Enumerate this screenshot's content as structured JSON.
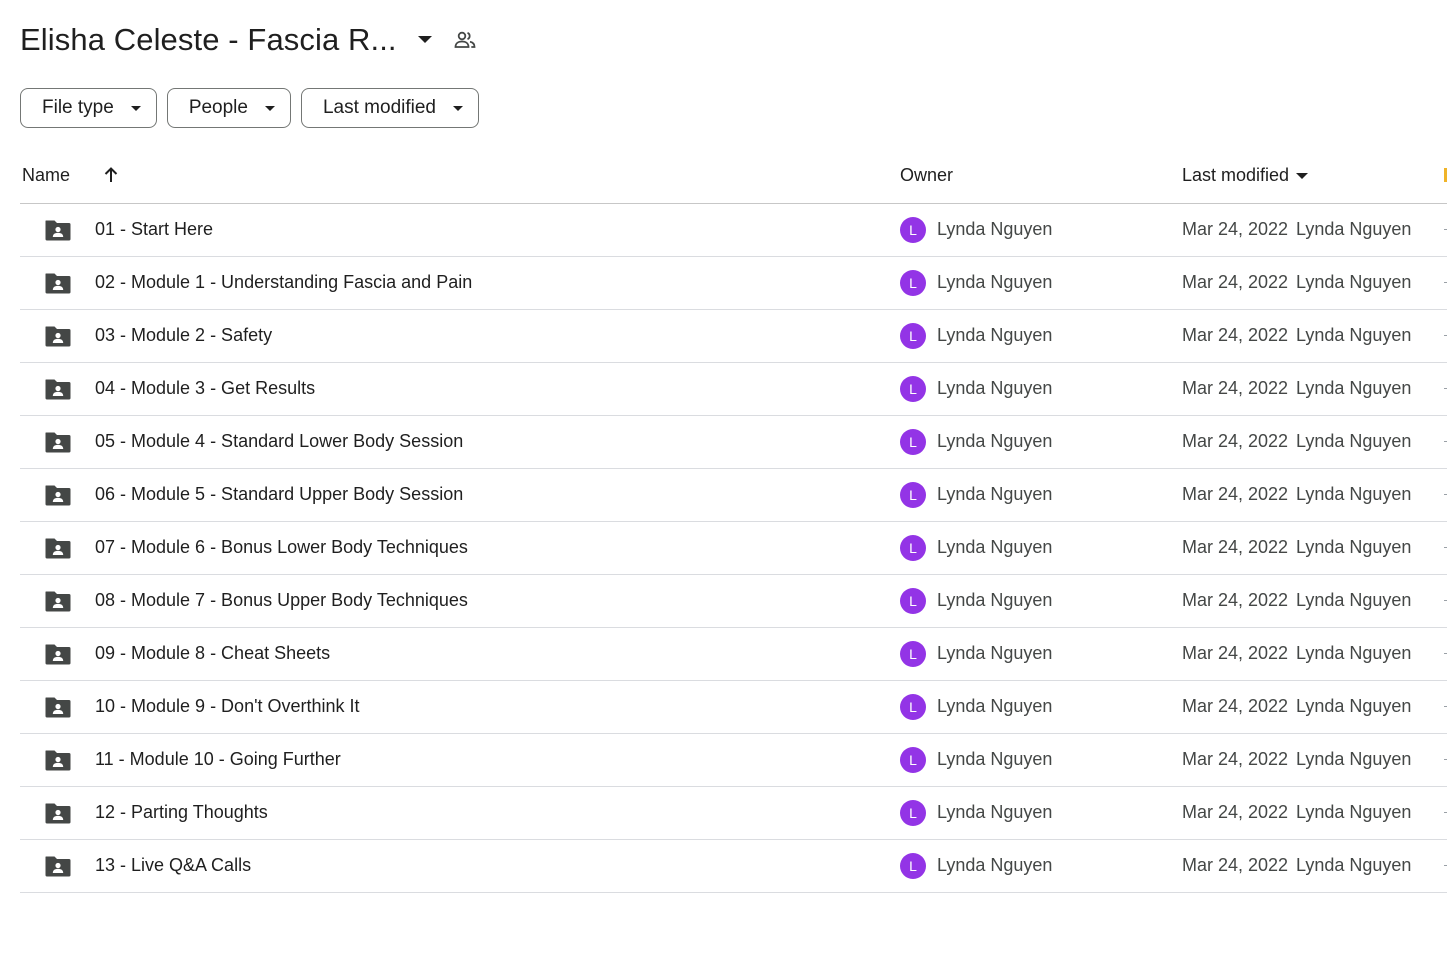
{
  "header": {
    "folder_title": "Elisha Celeste - Fascia R...",
    "title_dropdown_icon": "arrow-drop-down-icon",
    "shared_icon": "people-icon"
  },
  "filters": {
    "file_type": "File type",
    "people": "People",
    "last_modified": "Last modified"
  },
  "table": {
    "columns": {
      "name": "Name",
      "owner": "Owner",
      "last_modified": "Last modified"
    },
    "sort": {
      "column": "Name",
      "direction": "ascending",
      "icon": "arrow-up-icon"
    },
    "rows": [
      {
        "name": "01 - Start Here",
        "owner_initial": "L",
        "owner": "Lynda Nguyen",
        "modified_date": "Mar 24, 2022",
        "modified_by": "Lynda Nguyen"
      },
      {
        "name": "02 - Module 1 - Understanding Fascia and Pain",
        "owner_initial": "L",
        "owner": "Lynda Nguyen",
        "modified_date": "Mar 24, 2022",
        "modified_by": "Lynda Nguyen"
      },
      {
        "name": "03 - Module 2 - Safety",
        "owner_initial": "L",
        "owner": "Lynda Nguyen",
        "modified_date": "Mar 24, 2022",
        "modified_by": "Lynda Nguyen"
      },
      {
        "name": "04 - Module 3 - Get Results",
        "owner_initial": "L",
        "owner": "Lynda Nguyen",
        "modified_date": "Mar 24, 2022",
        "modified_by": "Lynda Nguyen"
      },
      {
        "name": "05 - Module 4 - Standard Lower Body Session",
        "owner_initial": "L",
        "owner": "Lynda Nguyen",
        "modified_date": "Mar 24, 2022",
        "modified_by": "Lynda Nguyen"
      },
      {
        "name": "06 - Module 5 - Standard Upper Body Session",
        "owner_initial": "L",
        "owner": "Lynda Nguyen",
        "modified_date": "Mar 24, 2022",
        "modified_by": "Lynda Nguyen"
      },
      {
        "name": "07 - Module 6 - Bonus Lower Body Techniques",
        "owner_initial": "L",
        "owner": "Lynda Nguyen",
        "modified_date": "Mar 24, 2022",
        "modified_by": "Lynda Nguyen"
      },
      {
        "name": "08 - Module 7 - Bonus Upper Body Techniques",
        "owner_initial": "L",
        "owner": "Lynda Nguyen",
        "modified_date": "Mar 24, 2022",
        "modified_by": "Lynda Nguyen"
      },
      {
        "name": "09 - Module 8 - Cheat Sheets",
        "owner_initial": "L",
        "owner": "Lynda Nguyen",
        "modified_date": "Mar 24, 2022",
        "modified_by": "Lynda Nguyen"
      },
      {
        "name": "10 - Module 9 - Don't Overthink It",
        "owner_initial": "L",
        "owner": "Lynda Nguyen",
        "modified_date": "Mar 24, 2022",
        "modified_by": "Lynda Nguyen"
      },
      {
        "name": "11 - Module 10 - Going Further",
        "owner_initial": "L",
        "owner": "Lynda Nguyen",
        "modified_date": "Mar 24, 2022",
        "modified_by": "Lynda Nguyen"
      },
      {
        "name": "12 - Parting Thoughts",
        "owner_initial": "L",
        "owner": "Lynda Nguyen",
        "modified_date": "Mar 24, 2022",
        "modified_by": "Lynda Nguyen"
      },
      {
        "name": "13 - Live Q&A Calls",
        "owner_initial": "L",
        "owner": "Lynda Nguyen",
        "modified_date": "Mar 24, 2022",
        "modified_by": "Lynda Nguyen"
      }
    ]
  },
  "colors": {
    "avatar": "#9334e6",
    "icon": "#444746",
    "text": "#1f1f1f",
    "secondary_text": "#444746",
    "chip_border": "#747775",
    "divider": "#dadce0"
  }
}
